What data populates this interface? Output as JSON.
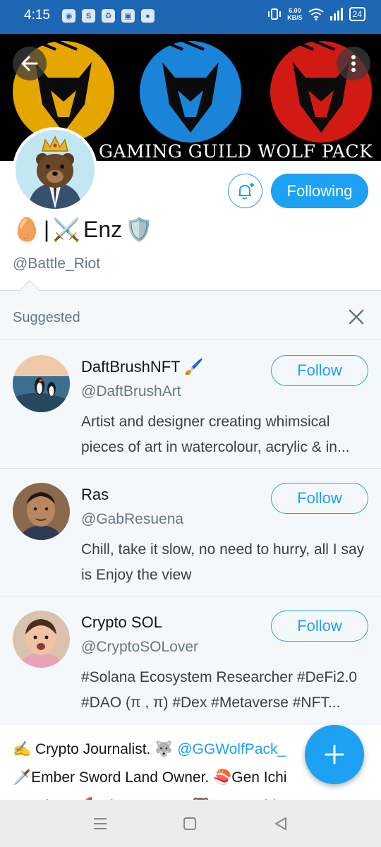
{
  "status_bar": {
    "time": "4:15",
    "net_speed_value": "6.00",
    "net_speed_unit": "KB/S",
    "battery": "24",
    "app_icons": [
      "discord-icon",
      "shopping-bag-icon",
      "recycle-icon",
      "twitch-icon",
      "chat-icon"
    ]
  },
  "header": {
    "banner_title": "GAMING GUILD WOLF PACK",
    "wolf_colors": [
      "#e6a600",
      "#1a84d8",
      "#d11a14"
    ]
  },
  "profile": {
    "display_name_parts": [
      "🥚",
      "|",
      "⚔️",
      "Enz",
      "🛡️"
    ],
    "handle": "@Battle_Riot",
    "following_label": "Following"
  },
  "suggested": {
    "title": "Suggested",
    "items": [
      {
        "name": "DaftBrushNFT 🖌️",
        "handle": "@DaftBrushArt",
        "bio": "Artist and designer creating whimsical pieces of art in watercolour, acrylic & in...",
        "follow_label": "Follow"
      },
      {
        "name": "Ras",
        "handle": "@GabResuena",
        "bio": "Chill, take it slow, no need to hurry, all I say is Enjoy the view",
        "follow_label": "Follow"
      },
      {
        "name": "Crypto SOL",
        "handle": "@CryptoSOLover",
        "bio": "#Solana Ecosystem Researcher #DeFi2.0 #DAO (π , π) #Dex #Metaverse #NFT...",
        "follow_label": "Follow"
      }
    ]
  },
  "bio": {
    "line1_a": "✍️ Crypto Journalist. 🐺 ",
    "line1_mention": "@GGWolfPack_",
    "line2": "🗡️Ember Sword Land Owner. 🍣Gen Ichi",
    "line3": "Member. 🚀Axie Manager. 🐻 ByB Holder"
  },
  "colors": {
    "accent": "#1da1f2",
    "status_bar": "#1d67b5",
    "muted_text": "#657786",
    "panel_bg": "#f5f8fa"
  }
}
